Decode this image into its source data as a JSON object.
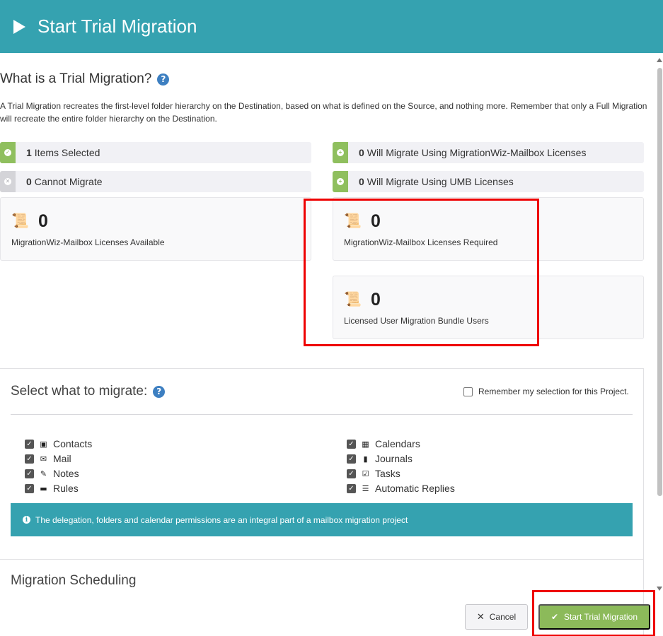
{
  "header": {
    "title": "Start Trial Migration"
  },
  "intro": {
    "title": "What is a Trial Migration?",
    "text": "A Trial Migration recreates the first-level folder hierarchy on the Destination, based on what is defined on the Source, and nothing more. Remember that only a Full Migration will recreate the entire folder hierarchy on the Destination."
  },
  "stats": {
    "selected": {
      "count": "1",
      "label": "Items Selected"
    },
    "cannot": {
      "count": "0",
      "label": "Cannot Migrate"
    },
    "mwiz": {
      "count": "0",
      "label": "Will Migrate Using MigrationWiz-Mailbox Licenses"
    },
    "umb": {
      "count": "0",
      "label": "Will Migrate Using UMB Licenses"
    }
  },
  "cards": {
    "available": {
      "value": "0",
      "label": "MigrationWiz-Mailbox Licenses Available"
    },
    "required": {
      "value": "0",
      "label": "MigrationWiz-Mailbox Licenses Required"
    },
    "umb_users": {
      "value": "0",
      "label": "Licensed User Migration Bundle Users"
    }
  },
  "select": {
    "title": "Select what to migrate:",
    "remember": "Remember my selection for this Project.",
    "left": [
      "Contacts",
      "Mail",
      "Notes",
      "Rules"
    ],
    "right": [
      "Calendars",
      "Journals",
      "Tasks",
      "Automatic Replies"
    ]
  },
  "info": {
    "text": "The delegation, folders and calendar permissions are an integral part of a mailbox migration project"
  },
  "scheduling": {
    "title": "Migration Scheduling"
  },
  "buttons": {
    "cancel": "Cancel",
    "start": "Start Trial Migration"
  }
}
